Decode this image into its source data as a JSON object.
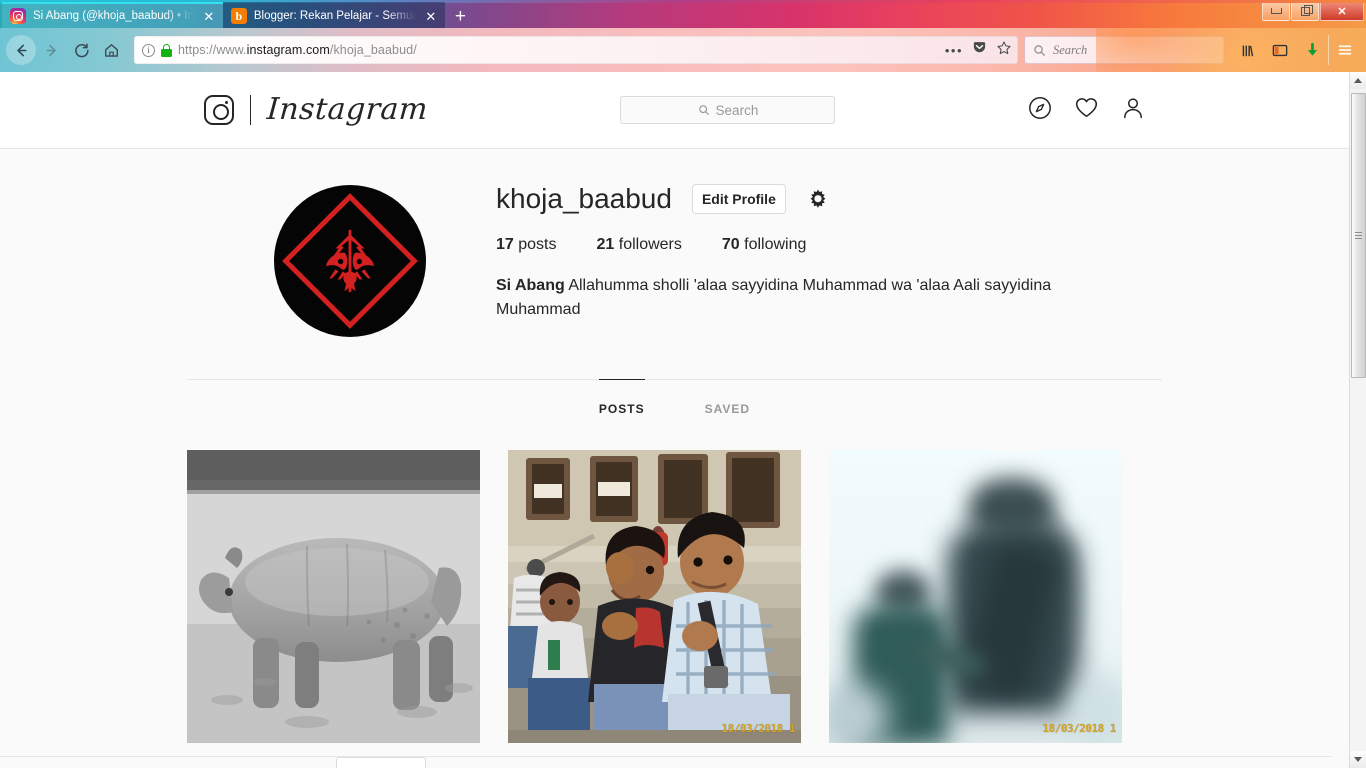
{
  "browser": {
    "tabs": [
      {
        "title": "Si Abang (@khoja_baabud) • In",
        "favicon": "instagram-icon",
        "active": true
      },
      {
        "title": "Blogger: Rekan Pelajar - Semua",
        "favicon": "blogger-icon",
        "active": false
      }
    ],
    "new_tab_label": "+",
    "window_controls": {
      "minimize": "minimize-button",
      "restore": "restore-button",
      "close": "✕"
    },
    "nav": {
      "back": "back-button",
      "forward": "forward-button",
      "reload": "reload-button",
      "home": "home-button"
    },
    "address_bar": {
      "scheme": "https://www.",
      "domain": "instagram.com",
      "path": "/khoja_baabud/",
      "full_url": "https://www.instagram.com/khoja_baabud/",
      "security": "secure-lock-icon"
    },
    "search_bar": {
      "placeholder": "Search"
    },
    "toolbar_icons": [
      "library-icon",
      "sidebar-icon",
      "downloads-icon",
      "menu-icon"
    ],
    "urlbar_icons": [
      "page-actions-icon",
      "pocket-icon",
      "bookmark-star-icon"
    ]
  },
  "instagram": {
    "brand": "Instagram",
    "logo_icon": "instagram-camera-icon",
    "search": {
      "placeholder": "Search",
      "icon": "search-icon"
    },
    "nav_icons": [
      "explore-compass-icon",
      "activity-heart-icon",
      "profile-person-icon"
    ],
    "profile": {
      "avatar_alt": "profile-avatar",
      "username": "khoja_baabud",
      "edit_button": "Edit Profile",
      "settings_icon": "gear-icon",
      "stats": [
        {
          "value": "17",
          "label": "posts"
        },
        {
          "value": "21",
          "label": "followers"
        },
        {
          "value": "70",
          "label": "following"
        }
      ],
      "full_name": "Si Abang",
      "bio": "Allahumma sholli 'alaa sayyidina Muhammad wa 'alaa Aali sayyidina Muhammad"
    },
    "tabs": [
      {
        "label": "POSTS",
        "active": true
      },
      {
        "label": "SAVED",
        "active": false
      }
    ],
    "posts": [
      {
        "alt": "black-and-white-rhinoceros-photo",
        "datestamp": ""
      },
      {
        "alt": "boys-sitting-on-steps-photo",
        "datestamp": "18/03/2018 1"
      },
      {
        "alt": "blurred-overexposed-two-figures-photo",
        "datestamp": "18/03/2018 1"
      }
    ]
  },
  "colors": {
    "instagram_text": "#262626",
    "muted_text": "#999999",
    "border": "#dbdbdb",
    "page_bg": "#fafafa",
    "avatar_red": "#d32020",
    "datestamp": "#d6a521"
  }
}
